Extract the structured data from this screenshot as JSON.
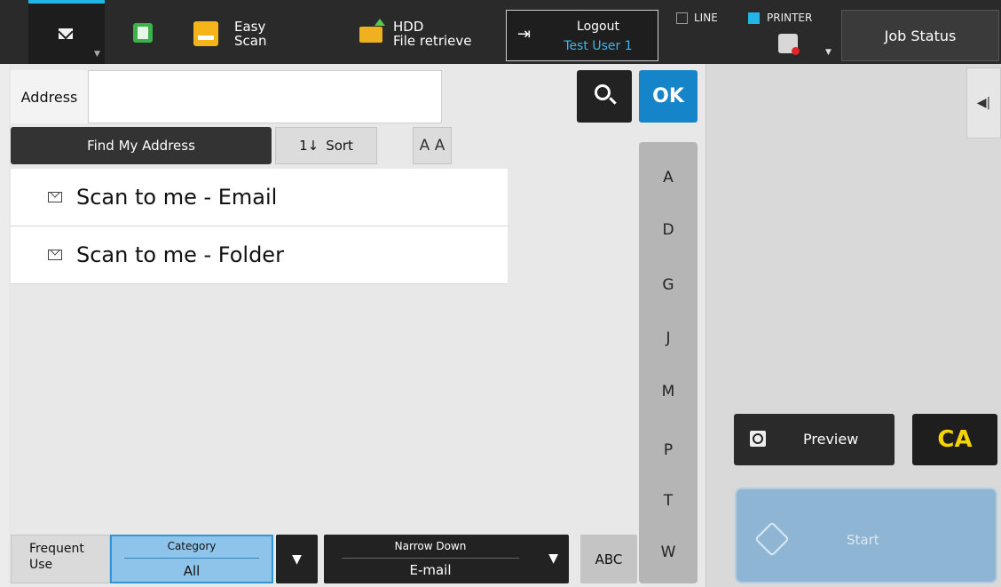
{
  "topbar": {
    "easy_scan": "Easy\nScan",
    "hdd": "HDD\nFile retrieve",
    "logout_label": "Logout",
    "user": "Test User 1",
    "line_label": "LINE",
    "printer_label": "PRINTER",
    "job_status": "Job Status"
  },
  "address": {
    "label": "Address",
    "value": "",
    "ok_label": "OK"
  },
  "toolbar": {
    "find_my_address": "Find My Address",
    "sort_prefix": "1↓",
    "sort_label": "Sort",
    "font_size_glyph": "A A"
  },
  "list": [
    {
      "name": "Scan to me - Email"
    },
    {
      "name": "Scan to me - Folder"
    }
  ],
  "alphabet": [
    "A",
    "D",
    "G",
    "J",
    "M",
    "P",
    "T",
    "W"
  ],
  "bottom": {
    "frequent_use": "Frequent\nUse",
    "category_title": "Category",
    "category_value": "All",
    "narrow_title": "Narrow Down",
    "narrow_value": "E-mail",
    "abc_label": "ABC"
  },
  "right": {
    "preview_label": "Preview",
    "ca_label": "CA",
    "start_label": "Start"
  },
  "colors": {
    "accent_blue": "#1684c8",
    "selected_tab": "#23b5e8",
    "user_text": "#3fb6e8",
    "ca_yellow": "#f5d300"
  }
}
